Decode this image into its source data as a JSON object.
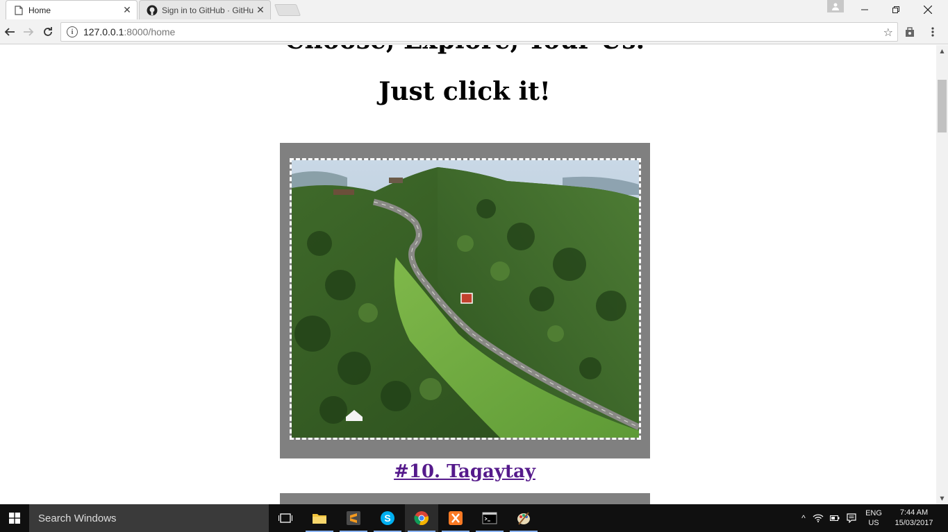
{
  "browser": {
    "tabs": [
      {
        "title": "Home",
        "icon": "page-icon"
      },
      {
        "title": "Sign in to GitHub · GitHu",
        "icon": "github-icon"
      }
    ],
    "url_host": "127.0.0.1",
    "url_path": ":8000/home"
  },
  "page": {
    "heading_top": "Choose, Explore, Your Us.",
    "heading_main": "Just click it!",
    "caption": "#10. Tagaytay",
    "caption_color": "#551a8b",
    "frame_color": "#808080"
  },
  "taskbar": {
    "search_placeholder": "Search Windows",
    "apps": [
      "task-view-icon",
      "file-explorer-icon",
      "sublime-text-icon",
      "skype-icon",
      "chrome-icon",
      "xampp-icon",
      "command-prompt-icon",
      "paint-icon"
    ],
    "lang_line1": "ENG",
    "lang_line2": "US",
    "time": "7:44 AM",
    "date": "15/03/2017"
  }
}
